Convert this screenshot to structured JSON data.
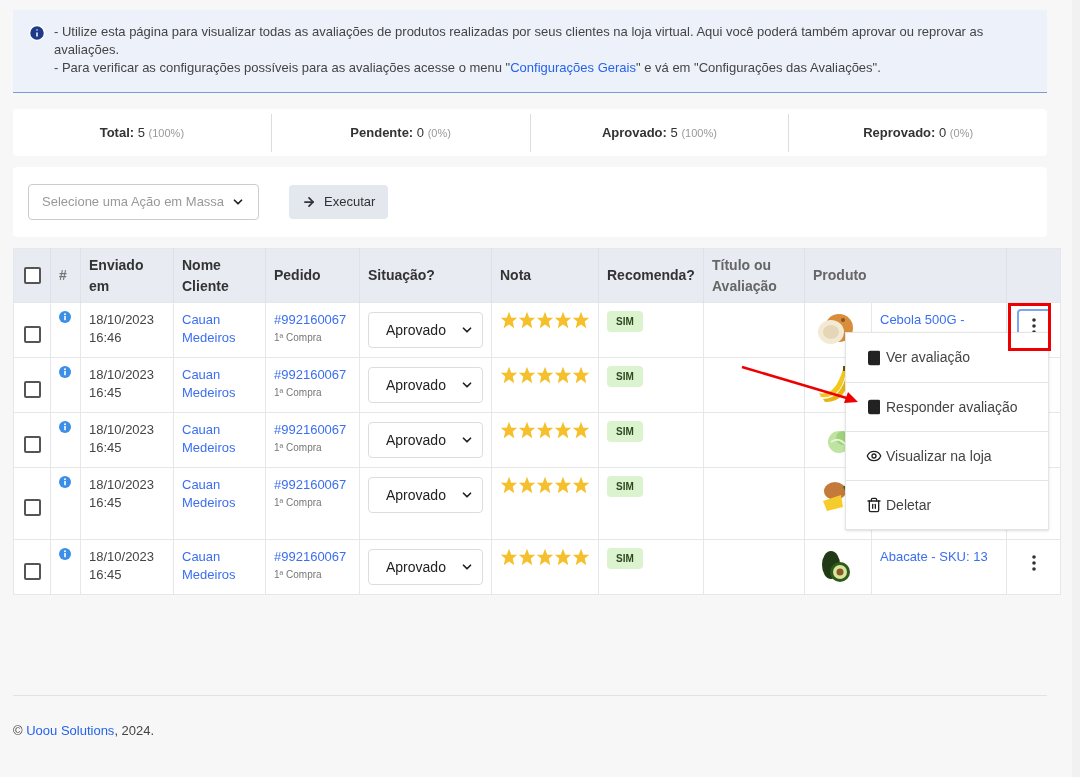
{
  "notice": {
    "lines": [
      "- Utilize esta página para visualizar todas as avaliações de produtos realizadas por seus clientes na loja virtual. Aqui você poderá também aprovar ou reprovar as avaliações."
    ],
    "config_line": {
      "before": "- Para verificar as configurações possíveis para as avaliações acesse o menu \"",
      "link": "Configurações Gerais",
      "after": "\" e vá em \"Configurações das Avaliações\"."
    }
  },
  "select_all_checked": false,
  "stats": [
    {
      "label": "Total:",
      "value": "5",
      "percent": "(100%)"
    },
    {
      "label": "Pendente:",
      "value": "0",
      "percent": "(0%)"
    },
    {
      "label": "Aprovado:",
      "value": "5",
      "percent": "(100%)"
    },
    {
      "label": "Reprovado:",
      "value": "0",
      "percent": "(0%)"
    }
  ],
  "bulk_action": {
    "placeholder": "Selecione uma Ação em Massa",
    "button": "Executar"
  },
  "table": {
    "columns": [
      "#",
      "Enviado em",
      "Nome Cliente",
      "Pedido",
      "Situação?",
      "Nota",
      "Recomenda?",
      "Título ou Avaliação",
      "Produto"
    ],
    "rows": [
      {
        "checked": false,
        "date": "18/10/2023",
        "time": "16:46",
        "client": "Cauan Medeiros",
        "order": "#992160067",
        "order_note": "1ª Compra",
        "status": "Aprovado",
        "stars": 5,
        "recommend": "SIM",
        "product": "Cebola 500G -",
        "menu_open": true
      },
      {
        "checked": false,
        "date": "18/10/2023",
        "time": "16:45",
        "client": "Cauan Medeiros",
        "order": "#992160067",
        "order_note": "1ª Compra",
        "status": "Aprovado",
        "stars": 5,
        "recommend": "SIM"
      },
      {
        "checked": false,
        "date": "18/10/2023",
        "time": "16:45",
        "client": "Cauan Medeiros",
        "order": "#992160067",
        "order_note": "1ª Compra",
        "status": "Aprovado",
        "stars": 5,
        "recommend": "SIM"
      },
      {
        "checked": false,
        "date": "18/10/2023",
        "time": "16:45",
        "client": "Cauan Medeiros",
        "order": "#992160067",
        "order_note": "1ª Compra",
        "status": "Aprovado",
        "stars": 5,
        "recommend": "SIM"
      },
      {
        "checked": false,
        "date": "18/10/2023",
        "time": "16:45",
        "client": "Cauan Medeiros",
        "order": "#992160067",
        "order_note": "1ª Compra",
        "status": "Aprovado",
        "stars": 5,
        "recommend": "SIM",
        "product": "Abacate - SKU: 13",
        "menu_open": false
      }
    ]
  },
  "row_menu": {
    "items": [
      {
        "kind": "book",
        "label": "Ver avaliação"
      },
      {
        "kind": "book",
        "label": "Responder avaliação"
      },
      {
        "kind": "eye",
        "label": "Visualizar na loja"
      },
      {
        "kind": "trash",
        "label": "Deletar"
      }
    ]
  },
  "footer": {
    "before": "© ",
    "link": "Uoou Solutions",
    "after": ", 2024."
  }
}
